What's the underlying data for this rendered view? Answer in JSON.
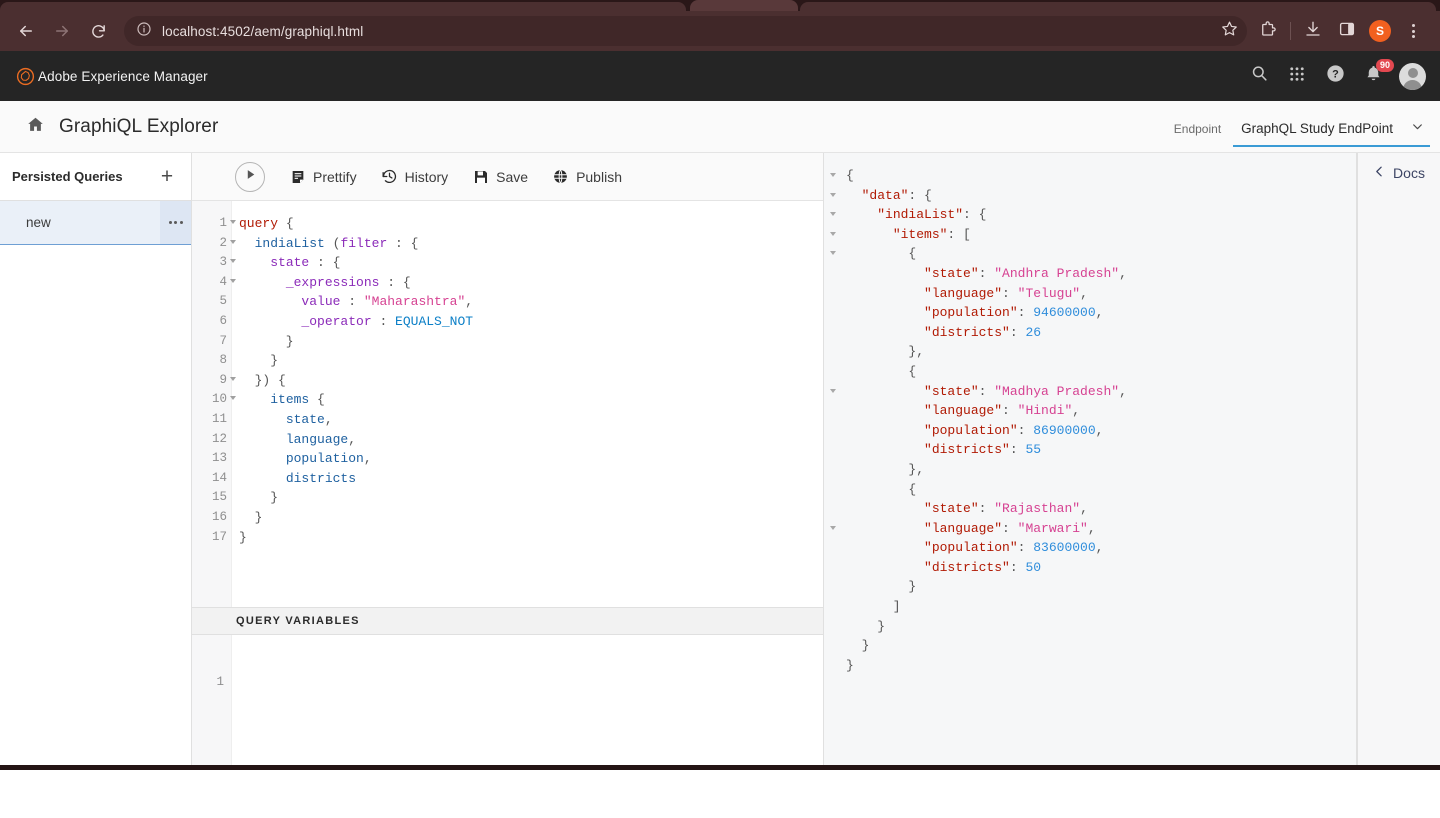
{
  "browser": {
    "url": "localhost:4502/aem/graphiql.html",
    "back_icon": "back-arrow-icon",
    "forward_icon": "forward-arrow-icon",
    "reload_icon": "reload-icon",
    "info_icon": "site-info-icon",
    "star_icon": "bookmark-star-icon",
    "extensions_icon": "extensions-puzzle-icon",
    "downloads_icon": "downloads-icon",
    "sidepanel_icon": "side-panel-icon",
    "profile_initial": "S",
    "menu_icon": "three-dot-menu-icon"
  },
  "aem_header": {
    "brand": "Adobe Experience Manager",
    "logo_icon": "adobe-aem-logo-icon",
    "search_icon": "search-icon",
    "apps_icon": "app-grid-icon",
    "help_icon": "help-question-icon",
    "bell_icon": "notification-bell-icon",
    "notification_count": "90",
    "avatar_icon": "user-avatar-icon"
  },
  "page": {
    "home_icon": "home-icon",
    "title": "GraphiQL Explorer",
    "endpoint_label": "Endpoint",
    "endpoint_value": "GraphQL Study EndPoint",
    "endpoint_caret_icon": "chevron-down-icon"
  },
  "sidebar": {
    "title": "Persisted Queries",
    "add_icon": "plus-icon",
    "add_label": "+",
    "items": [
      {
        "label": "new",
        "menu_icon": "more-options-icon",
        "selected": true
      }
    ]
  },
  "toolbar": {
    "execute_icon": "play-execute-icon",
    "buttons": [
      {
        "label": "Prettify",
        "icon": "prettify-document-icon"
      },
      {
        "label": "History",
        "icon": "history-clock-icon"
      },
      {
        "label": "Save",
        "icon": "save-floppy-icon"
      },
      {
        "label": "Publish",
        "icon": "publish-globe-icon"
      }
    ]
  },
  "docs": {
    "label": "Docs",
    "icon": "chevron-left-icon"
  },
  "query_editor": {
    "line_numbers": [
      "1",
      "2",
      "3",
      "4",
      "5",
      "6",
      "7",
      "8",
      "9",
      "10",
      "11",
      "12",
      "13",
      "14",
      "15",
      "16",
      "17"
    ],
    "foldable_lines": [
      1,
      2,
      3,
      4,
      9,
      10
    ],
    "lines": [
      [
        {
          "t": "query",
          "c": "k-query"
        },
        {
          "t": " {",
          "c": "k-punct"
        }
      ],
      [
        {
          "t": "  ",
          "c": "k-plain"
        },
        {
          "t": "indiaList",
          "c": "k-field"
        },
        {
          "t": " (",
          "c": "k-punct"
        },
        {
          "t": "filter",
          "c": "k-arg"
        },
        {
          "t": " : {",
          "c": "k-punct"
        }
      ],
      [
        {
          "t": "    ",
          "c": "k-plain"
        },
        {
          "t": "state",
          "c": "k-arg"
        },
        {
          "t": " : {",
          "c": "k-punct"
        }
      ],
      [
        {
          "t": "      ",
          "c": "k-plain"
        },
        {
          "t": "_expressions",
          "c": "k-arg"
        },
        {
          "t": " : {",
          "c": "k-punct"
        }
      ],
      [
        {
          "t": "        ",
          "c": "k-plain"
        },
        {
          "t": "value",
          "c": "k-arg"
        },
        {
          "t": " : ",
          "c": "k-punct"
        },
        {
          "t": "\"Maharashtra\"",
          "c": "k-string"
        },
        {
          "t": ",",
          "c": "k-punct"
        }
      ],
      [
        {
          "t": "        ",
          "c": "k-plain"
        },
        {
          "t": "_operator",
          "c": "k-arg"
        },
        {
          "t": " : ",
          "c": "k-punct"
        },
        {
          "t": "EQUALS_NOT",
          "c": "k-enum"
        }
      ],
      [
        {
          "t": "      }",
          "c": "k-punct"
        }
      ],
      [
        {
          "t": "    }",
          "c": "k-punct"
        }
      ],
      [
        {
          "t": "  })",
          "c": "k-punct"
        },
        {
          "t": " {",
          "c": "k-punct"
        }
      ],
      [
        {
          "t": "    ",
          "c": "k-plain"
        },
        {
          "t": "items",
          "c": "k-field"
        },
        {
          "t": " {",
          "c": "k-punct"
        }
      ],
      [
        {
          "t": "      ",
          "c": "k-plain"
        },
        {
          "t": "state",
          "c": "k-field"
        },
        {
          "t": ",",
          "c": "k-punct"
        }
      ],
      [
        {
          "t": "      ",
          "c": "k-plain"
        },
        {
          "t": "language",
          "c": "k-field"
        },
        {
          "t": ",",
          "c": "k-punct"
        }
      ],
      [
        {
          "t": "      ",
          "c": "k-plain"
        },
        {
          "t": "population",
          "c": "k-field"
        },
        {
          "t": ",",
          "c": "k-punct"
        }
      ],
      [
        {
          "t": "      ",
          "c": "k-plain"
        },
        {
          "t": "districts",
          "c": "k-field"
        }
      ],
      [
        {
          "t": "    }",
          "c": "k-punct"
        }
      ],
      [
        {
          "t": "  }",
          "c": "k-punct"
        }
      ],
      [
        {
          "t": "}",
          "c": "k-punct"
        }
      ]
    ]
  },
  "query_variables": {
    "title": "QUERY VARIABLES",
    "line_numbers": [
      "1"
    ],
    "value": ""
  },
  "results": {
    "foldable_rows": [
      0,
      1,
      2,
      3,
      4,
      11,
      18
    ],
    "lines": [
      [
        {
          "t": "{",
          "c": "j-pun"
        }
      ],
      [
        {
          "t": "  ",
          "c": "j-pun"
        },
        {
          "t": "\"data\"",
          "c": "j-key"
        },
        {
          "t": ": {",
          "c": "j-pun"
        }
      ],
      [
        {
          "t": "    ",
          "c": "j-pun"
        },
        {
          "t": "\"indiaList\"",
          "c": "j-key"
        },
        {
          "t": ": {",
          "c": "j-pun"
        }
      ],
      [
        {
          "t": "      ",
          "c": "j-pun"
        },
        {
          "t": "\"items\"",
          "c": "j-key"
        },
        {
          "t": ": [",
          "c": "j-pun"
        }
      ],
      [
        {
          "t": "        {",
          "c": "j-pun"
        }
      ],
      [
        {
          "t": "          ",
          "c": "j-pun"
        },
        {
          "t": "\"state\"",
          "c": "j-key"
        },
        {
          "t": ": ",
          "c": "j-pun"
        },
        {
          "t": "\"Andhra Pradesh\"",
          "c": "j-str"
        },
        {
          "t": ",",
          "c": "j-pun"
        }
      ],
      [
        {
          "t": "          ",
          "c": "j-pun"
        },
        {
          "t": "\"language\"",
          "c": "j-key"
        },
        {
          "t": ": ",
          "c": "j-pun"
        },
        {
          "t": "\"Telugu\"",
          "c": "j-str"
        },
        {
          "t": ",",
          "c": "j-pun"
        }
      ],
      [
        {
          "t": "          ",
          "c": "j-pun"
        },
        {
          "t": "\"population\"",
          "c": "j-key"
        },
        {
          "t": ": ",
          "c": "j-pun"
        },
        {
          "t": "94600000",
          "c": "j-num"
        },
        {
          "t": ",",
          "c": "j-pun"
        }
      ],
      [
        {
          "t": "          ",
          "c": "j-pun"
        },
        {
          "t": "\"districts\"",
          "c": "j-key"
        },
        {
          "t": ": ",
          "c": "j-pun"
        },
        {
          "t": "26",
          "c": "j-num"
        }
      ],
      [
        {
          "t": "        },",
          "c": "j-pun"
        }
      ],
      [
        {
          "t": "        {",
          "c": "j-pun"
        }
      ],
      [
        {
          "t": "          ",
          "c": "j-pun"
        },
        {
          "t": "\"state\"",
          "c": "j-key"
        },
        {
          "t": ": ",
          "c": "j-pun"
        },
        {
          "t": "\"Madhya Pradesh\"",
          "c": "j-str"
        },
        {
          "t": ",",
          "c": "j-pun"
        }
      ],
      [
        {
          "t": "          ",
          "c": "j-pun"
        },
        {
          "t": "\"language\"",
          "c": "j-key"
        },
        {
          "t": ": ",
          "c": "j-pun"
        },
        {
          "t": "\"Hindi\"",
          "c": "j-str"
        },
        {
          "t": ",",
          "c": "j-pun"
        }
      ],
      [
        {
          "t": "          ",
          "c": "j-pun"
        },
        {
          "t": "\"population\"",
          "c": "j-key"
        },
        {
          "t": ": ",
          "c": "j-pun"
        },
        {
          "t": "86900000",
          "c": "j-num"
        },
        {
          "t": ",",
          "c": "j-pun"
        }
      ],
      [
        {
          "t": "          ",
          "c": "j-pun"
        },
        {
          "t": "\"districts\"",
          "c": "j-key"
        },
        {
          "t": ": ",
          "c": "j-pun"
        },
        {
          "t": "55",
          "c": "j-num"
        }
      ],
      [
        {
          "t": "        },",
          "c": "j-pun"
        }
      ],
      [
        {
          "t": "        {",
          "c": "j-pun"
        }
      ],
      [
        {
          "t": "          ",
          "c": "j-pun"
        },
        {
          "t": "\"state\"",
          "c": "j-key"
        },
        {
          "t": ": ",
          "c": "j-pun"
        },
        {
          "t": "\"Rajasthan\"",
          "c": "j-str"
        },
        {
          "t": ",",
          "c": "j-pun"
        }
      ],
      [
        {
          "t": "          ",
          "c": "j-pun"
        },
        {
          "t": "\"language\"",
          "c": "j-key"
        },
        {
          "t": ": ",
          "c": "j-pun"
        },
        {
          "t": "\"Marwari\"",
          "c": "j-str"
        },
        {
          "t": ",",
          "c": "j-pun"
        }
      ],
      [
        {
          "t": "          ",
          "c": "j-pun"
        },
        {
          "t": "\"population\"",
          "c": "j-key"
        },
        {
          "t": ": ",
          "c": "j-pun"
        },
        {
          "t": "83600000",
          "c": "j-num"
        },
        {
          "t": ",",
          "c": "j-pun"
        }
      ],
      [
        {
          "t": "          ",
          "c": "j-pun"
        },
        {
          "t": "\"districts\"",
          "c": "j-key"
        },
        {
          "t": ": ",
          "c": "j-pun"
        },
        {
          "t": "50",
          "c": "j-num"
        }
      ],
      [
        {
          "t": "        }",
          "c": "j-pun"
        }
      ],
      [
        {
          "t": "      ]",
          "c": "j-pun"
        }
      ],
      [
        {
          "t": "    }",
          "c": "j-pun"
        }
      ],
      [
        {
          "t": "  }",
          "c": "j-pun"
        }
      ],
      [
        {
          "t": "}",
          "c": "j-pun"
        }
      ]
    ],
    "records": [
      {
        "state": "Andhra Pradesh",
        "language": "Telugu",
        "population": 94600000,
        "districts": 26
      },
      {
        "state": "Madhya Pradesh",
        "language": "Hindi",
        "population": 86900000,
        "districts": 55
      },
      {
        "state": "Rajasthan",
        "language": "Marwari",
        "population": 83600000,
        "districts": 50
      }
    ]
  },
  "colors": {
    "browser_chrome": "#4b2f30",
    "aem_header": "#252525",
    "accent_underline": "#3a9bd5",
    "selected_item_bg": "#eaf0f8",
    "badge_red": "#e34850",
    "profile_orange": "#f2601f"
  }
}
